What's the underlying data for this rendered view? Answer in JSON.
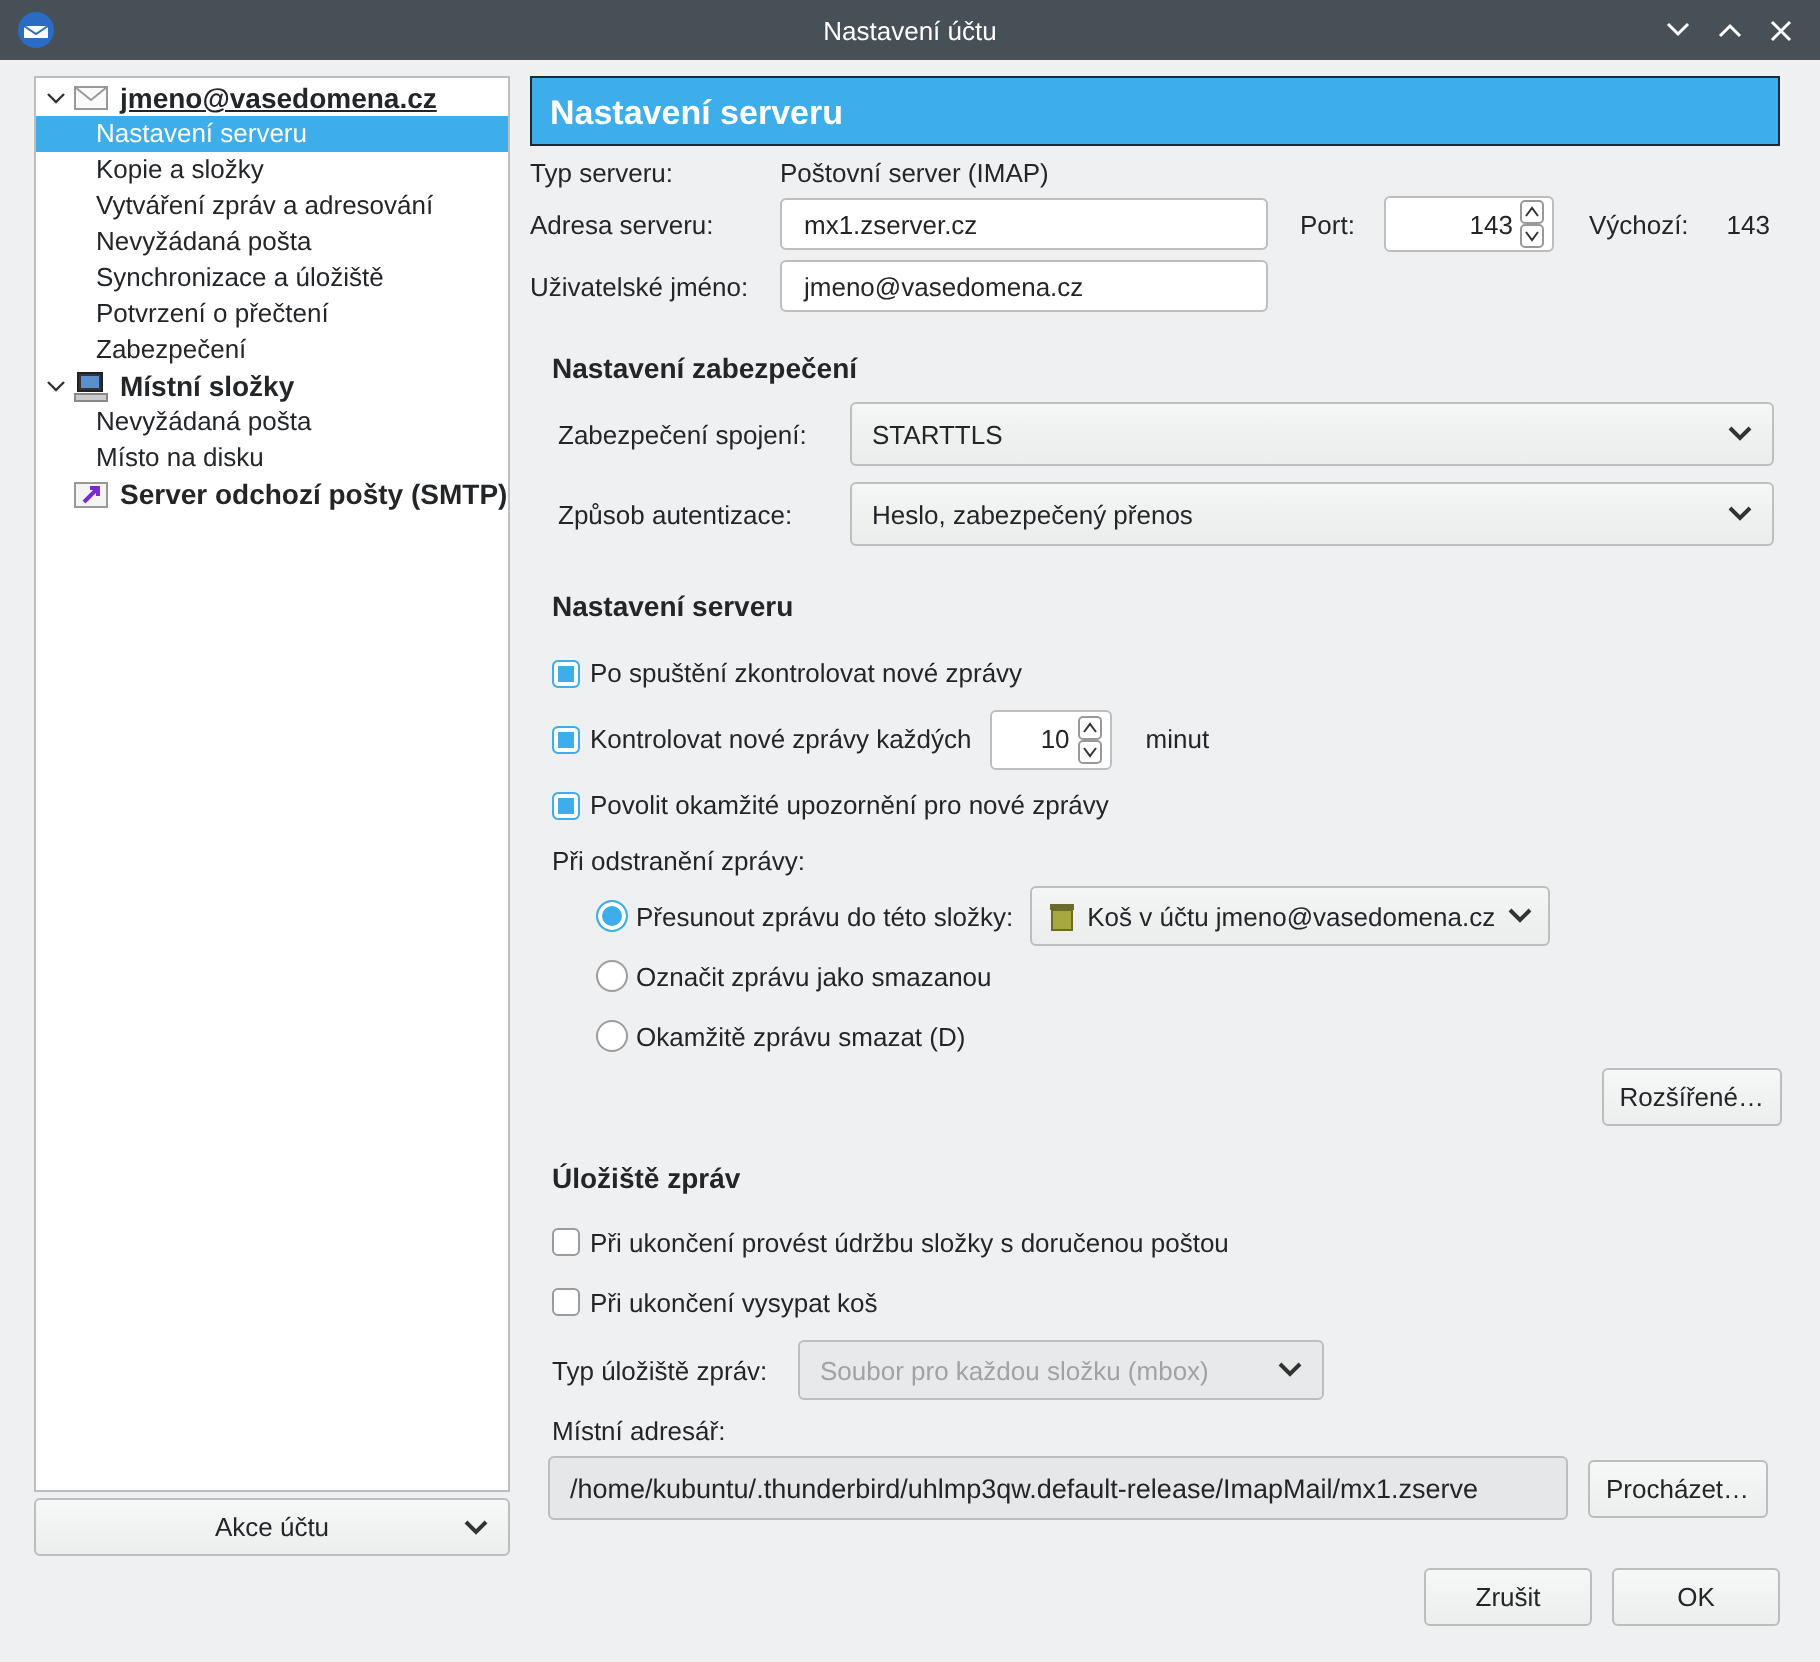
{
  "window": {
    "title": "Nastavení účtu"
  },
  "sidebar": {
    "items": [
      {
        "label": "jmeno@vasedomena.cz",
        "kind": "mail",
        "expanded": true,
        "children": [
          {
            "label": "Nastavení serveru",
            "selected": true
          },
          {
            "label": "Kopie a složky",
            "selected": false
          },
          {
            "label": "Vytváření zpráv a adresování",
            "selected": false
          },
          {
            "label": "Nevyžádaná pošta",
            "selected": false
          },
          {
            "label": "Synchronizace a úložiště",
            "selected": false
          },
          {
            "label": "Potvrzení o přečtení",
            "selected": false
          },
          {
            "label": "Zabezpečení",
            "selected": false
          }
        ]
      },
      {
        "label": "Místní složky",
        "kind": "computer",
        "expanded": true,
        "children": [
          {
            "label": "Nevyžádaná pošta",
            "selected": false
          },
          {
            "label": "Místo na disku",
            "selected": false
          }
        ]
      },
      {
        "label": "Server odchozí pošty (SMTP)",
        "kind": "outgoing"
      }
    ],
    "action_button": "Akce účtu"
  },
  "header": "Nastavení serveru",
  "server": {
    "type_label": "Typ serveru:",
    "type_value": "Poštovní server (IMAP)",
    "address_label": "Adresa serveru:",
    "address": "mx1.zserver.cz",
    "port_label": "Port:",
    "port": "143",
    "default_label": "Výchozí:",
    "default_value": "143",
    "user_label": "Uživatelské jméno:",
    "user": "jmeno@vasedomena.cz"
  },
  "security": {
    "heading": "Nastavení zabezpečení",
    "fields": [
      {
        "label": "Zabezpečení spojení:",
        "value": "STARTTLS"
      },
      {
        "label": "Způsob autentizace:",
        "value": "Heslo, zabezpečený přenos"
      }
    ]
  },
  "server_settings": {
    "heading": "Nastavení serveru",
    "checks": [
      {
        "label": "Po spuštění zkontrolovat nové zprávy",
        "checked": true
      },
      {
        "label": "Kontrolovat nové zprávy každých",
        "checked": true,
        "value": "10",
        "unit": "minut"
      },
      {
        "label": "Povolit okamžité upozornění pro nové zprávy",
        "checked": true
      }
    ],
    "delete_label": "Při odstranění zprávy:",
    "delete_options": [
      {
        "label": "Přesunout zprávu do této složky:",
        "selected": true,
        "folder": "Koš v účtu jmeno@vasedomena.cz"
      },
      {
        "label": "Označit zprávu jako smazanou",
        "selected": false
      },
      {
        "label": "Okamžitě zprávu smazat (D)",
        "selected": false
      }
    ],
    "advanced_button": "Rozšířené…"
  },
  "storage": {
    "heading": "Úložiště zpráv",
    "checks": [
      {
        "label": "Při ukončení provést údržbu složky s doručenou poštou",
        "checked": false
      },
      {
        "label": "Při ukončení vysypat koš",
        "checked": false
      }
    ],
    "type_label": "Typ úložiště zpráv:",
    "type_value": "Soubor pro každou složku (mbox)",
    "type_disabled": true,
    "dir_label": "Místní adresář:",
    "dir_value": "/home/kubuntu/.thunderbird/uhlmp3qw.default-release/ImapMail/mx1.zserve",
    "browse_button": "Procházet…"
  },
  "buttons": [
    "Zrušit",
    "OK"
  ]
}
